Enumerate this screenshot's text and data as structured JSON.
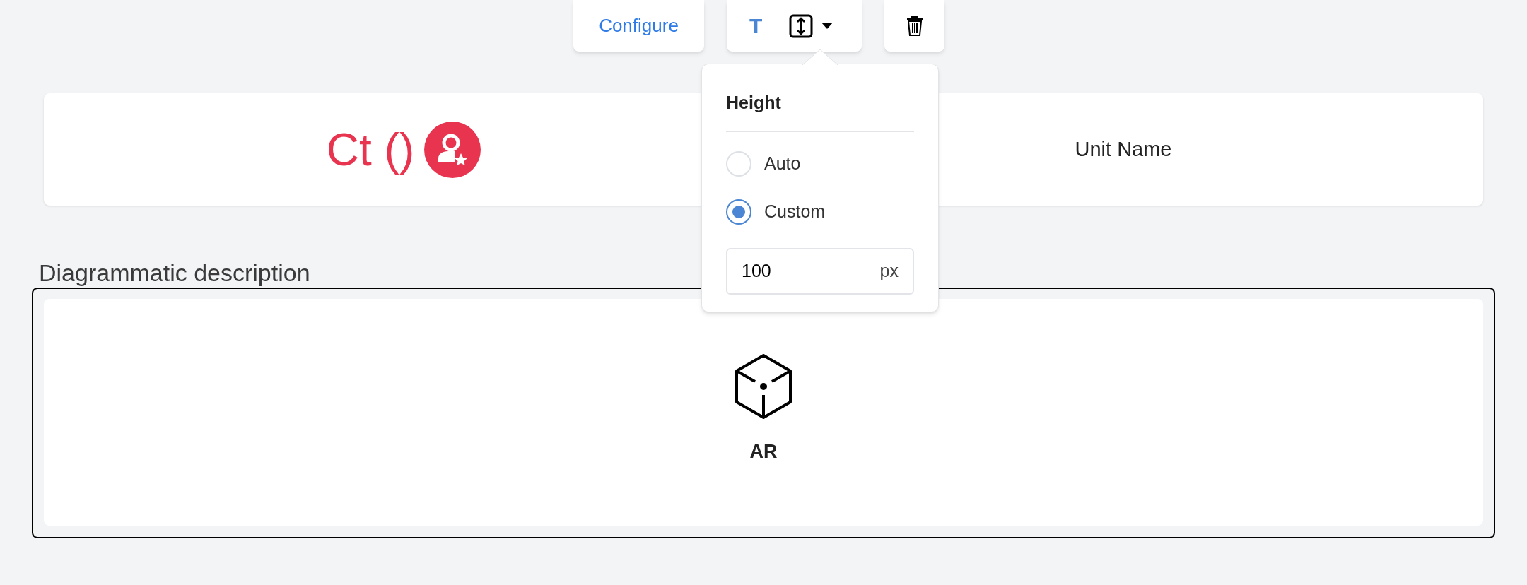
{
  "toolbar": {
    "configure_button": "Configure",
    "text_button": "T"
  },
  "height_popover": {
    "title": "Height",
    "options": [
      {
        "label": "Auto",
        "selected": false
      },
      {
        "label": "Custom",
        "selected": true
      }
    ],
    "value": "100",
    "unit": "px"
  },
  "header_card": {
    "title": "Ct ()",
    "unit_name": "Unit Name"
  },
  "section": {
    "title": "Diagrammatic description",
    "ar_label": "AR"
  }
}
